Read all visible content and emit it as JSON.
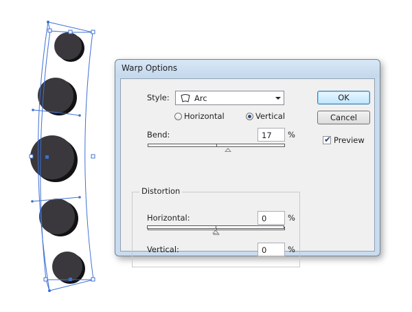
{
  "dialog": {
    "title": "Warp Options",
    "style_label": "Style:",
    "style_value": "Arc",
    "orientation": {
      "horizontal_label": "Horizontal",
      "vertical_label": "Vertical",
      "selected": "Vertical"
    },
    "bend": {
      "label": "Bend:",
      "value": "17",
      "unit": "%",
      "slider_percent": 17
    },
    "distortion": {
      "group_label": "Distortion",
      "horizontal": {
        "label": "Horizontal:",
        "value": "0",
        "unit": "%",
        "slider_percent": 0
      },
      "vertical": {
        "label": "Vertical:",
        "value": "0",
        "unit": "%",
        "slider_percent": 0
      }
    },
    "buttons": {
      "ok": "OK",
      "cancel": "Cancel"
    },
    "preview": {
      "label": "Preview",
      "checked": true
    }
  },
  "colors": {
    "circle_fill": "#3a383c",
    "bounding_box": "#3c6fd3",
    "dialog_frame": "#c9dcef",
    "client_bg": "#f0f0f0"
  }
}
